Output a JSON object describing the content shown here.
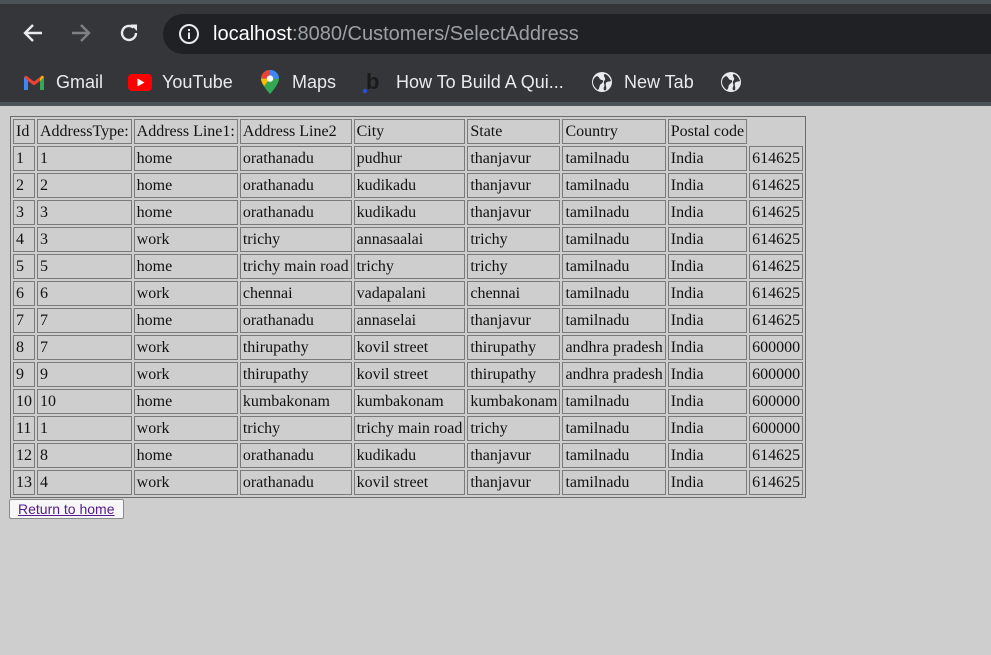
{
  "browser": {
    "url_host": "localhost",
    "url_rest": ":8080/Customers/SelectAddress",
    "bookmarks": [
      {
        "label": "Gmail",
        "icon": "gmail-icon"
      },
      {
        "label": "YouTube",
        "icon": "youtube-icon"
      },
      {
        "label": "Maps",
        "icon": "maps-icon"
      },
      {
        "label": "How To Build A Qui...",
        "icon": "b-logo-icon"
      },
      {
        "label": "New Tab",
        "icon": "globe-icon"
      },
      {
        "label": "",
        "icon": "globe-icon"
      }
    ]
  },
  "table": {
    "headers": [
      "Id",
      "AddressType:",
      "Address Line1:",
      "Address Line2",
      "City",
      "State",
      "Country",
      "Postal code",
      ""
    ],
    "rows": [
      [
        "1",
        "1",
        "home",
        "orathanadu",
        "pudhur",
        "thanjavur",
        "tamilnadu",
        "India",
        "614625"
      ],
      [
        "2",
        "2",
        "home",
        "orathanadu",
        "kudikadu",
        "thanjavur",
        "tamilnadu",
        "India",
        "614625"
      ],
      [
        "3",
        "3",
        "home",
        "orathanadu",
        "kudikadu",
        "thanjavur",
        "tamilnadu",
        "India",
        "614625"
      ],
      [
        "4",
        "3",
        "work",
        "trichy",
        "annasaalai",
        "trichy",
        "tamilnadu",
        "India",
        "614625"
      ],
      [
        "5",
        "5",
        "home",
        "trichy main road",
        "trichy",
        "trichy",
        "tamilnadu",
        "India",
        "614625"
      ],
      [
        "6",
        "6",
        "work",
        "chennai",
        "vadapalani",
        "chennai",
        "tamilnadu",
        "India",
        "614625"
      ],
      [
        "7",
        "7",
        "home",
        "orathanadu",
        "annaselai",
        "thanjavur",
        "tamilnadu",
        "India",
        "614625"
      ],
      [
        "8",
        "7",
        "work",
        "thirupathy",
        "kovil street",
        "thirupathy",
        "andhra pradesh",
        "India",
        "600000"
      ],
      [
        "9",
        "9",
        "work",
        "thirupathy",
        "kovil street",
        "thirupathy",
        "andhra pradesh",
        "India",
        "600000"
      ],
      [
        "10",
        "10",
        "home",
        "kumbakonam",
        "kumbakonam",
        "kumbakonam",
        "tamilnadu",
        "India",
        "600000"
      ],
      [
        "11",
        "1",
        "work",
        "trichy",
        "trichy main road",
        "trichy",
        "tamilnadu",
        "India",
        "600000"
      ],
      [
        "12",
        "8",
        "home",
        "orathanadu",
        "kudikadu",
        "thanjavur",
        "tamilnadu",
        "India",
        "614625"
      ],
      [
        "13",
        "4",
        "work",
        "orathanadu",
        "kovil street",
        "thanjavur",
        "tamilnadu",
        "India",
        "614625"
      ]
    ]
  },
  "actions": {
    "return_label": "Return to home"
  }
}
